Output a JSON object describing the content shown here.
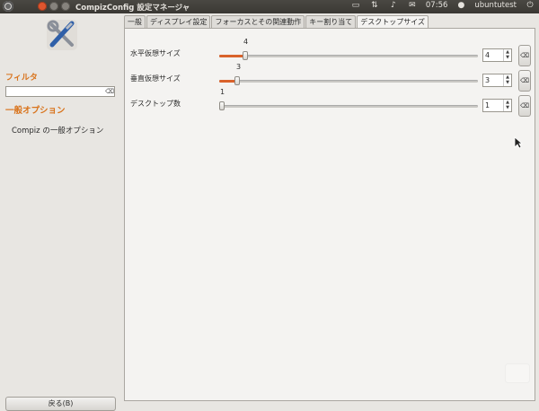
{
  "window": {
    "title": "CompizConfig 設定マネージャ"
  },
  "tray": {
    "time": "07:56",
    "user": "ubuntutest"
  },
  "left": {
    "filter_label": "フィルタ",
    "filter_value": "",
    "section_title": "一般オプション",
    "item": "Compiz の一般オプション",
    "back_button": "戻る(B)"
  },
  "tabs": [
    "一般",
    "ディスプレイ設定",
    "フォーカスとその関連動作",
    "キー割り当て",
    "デスクトップサイズ"
  ],
  "active_tab": "デスクトップサイズ",
  "settings": [
    {
      "label": "水平仮想サイズ",
      "value": "4",
      "slider_fraction": 0.09
    },
    {
      "label": "垂直仮想サイズ",
      "value": "3",
      "slider_fraction": 0.06
    },
    {
      "label": "デスクトップ数",
      "value": "1",
      "slider_fraction": 0.0
    }
  ],
  "colors": {
    "accent": "#d9731b",
    "slider_fill": "#d9622b",
    "panel_bg": "#3a3834"
  }
}
